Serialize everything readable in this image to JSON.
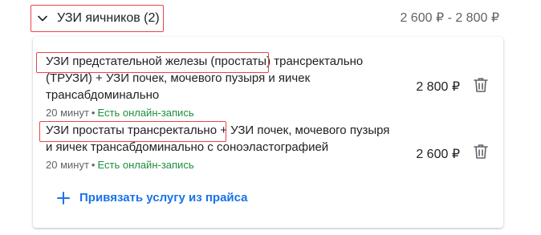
{
  "group": {
    "title": "УЗИ яичников (2)",
    "price_range": "2 600 ₽ - 2 800 ₽",
    "expand_icon": "chevron-down-icon"
  },
  "services": [
    {
      "name_highlight": "УЗИ предстательной железы (простаты)",
      "name_rest_line1": " трансректально",
      "name_rest": "(ТРУЗИ) + УЗИ почек, мочевого пузыря и яичек трансабдоминально",
      "duration": "20 минут",
      "separator": "•",
      "online": "Есть онлайн-запись",
      "price": "2 800 ₽",
      "delete_icon": "trash-icon"
    },
    {
      "name_highlight": "УЗИ простаты трансректально",
      "name_rest": " + УЗИ почек, мочевого пузыря и яичек трансабдоминально с соноэластографией",
      "duration": "20 минут",
      "separator": "•",
      "online": "Есть онлайн-запись",
      "price": "2 600 ₽",
      "delete_icon": "trash-icon"
    }
  ],
  "link": {
    "label": "Привязать услугу из прайса",
    "icon": "plus-icon"
  },
  "colors": {
    "accent_blue": "#1a73e8",
    "online_green": "#1e8e3e",
    "highlight_red": "#e8454a"
  }
}
